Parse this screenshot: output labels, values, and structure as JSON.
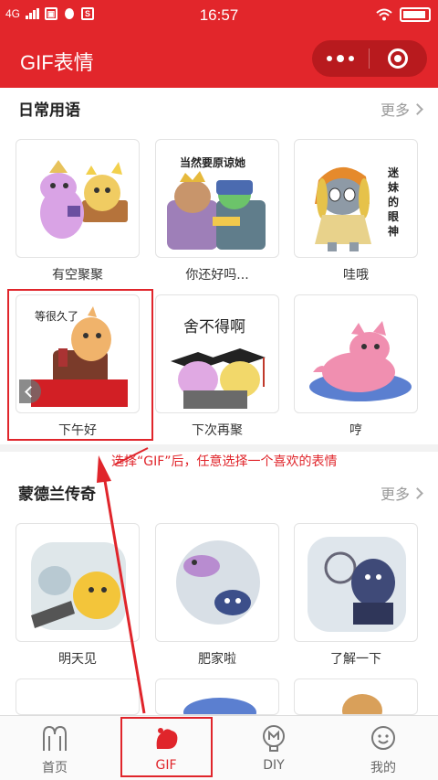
{
  "status_bar": {
    "network": "4G",
    "time": "16:57"
  },
  "header": {
    "title": "GIF表情"
  },
  "sections": [
    {
      "title": "日常用语",
      "more_label": "更多",
      "items": [
        {
          "label": "有空聚聚"
        },
        {
          "label": "你还好吗...",
          "caption": "当然要原谅她"
        },
        {
          "label": "哇哦",
          "caption": "迷妹的眼神"
        },
        {
          "label": "下午好",
          "caption": "等很久了"
        },
        {
          "label": "下次再聚",
          "caption": "舍不得啊"
        },
        {
          "label": "哼"
        }
      ]
    },
    {
      "title": "蒙德兰传奇",
      "more_label": "更多",
      "items": [
        {
          "label": "明天见"
        },
        {
          "label": "肥家啦"
        },
        {
          "label": "了解一下"
        }
      ]
    }
  ],
  "annotation": {
    "text": "选择“GIF”后，任意选择一个喜欢的表情"
  },
  "bottom_nav": {
    "items": [
      {
        "label": "首页",
        "icon": "home-arch-icon"
      },
      {
        "label": "GIF",
        "icon": "gif-fist-icon",
        "active": true
      },
      {
        "label": "DIY",
        "icon": "diy-icon"
      },
      {
        "label": "我的",
        "icon": "profile-face-icon"
      }
    ]
  },
  "colors": {
    "brand_red": "#e2262b",
    "annotation_red": "#e0252b"
  }
}
